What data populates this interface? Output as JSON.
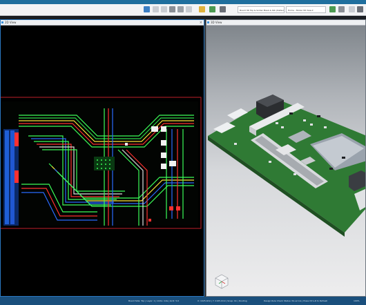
{
  "toolbar": {
    "layer_select": "Board 3D Top & Solder Mask & Silk (Default) ▾",
    "view_select": "Home - Model 3D View ▾",
    "icons": [
      "save-icon",
      "undo-icon",
      "redo-icon",
      "print-icon",
      "lock-icon",
      "zoom-icon",
      "measure-icon",
      "layer-icon",
      "settings-icon",
      "help-icon",
      "user-icon"
    ]
  },
  "pane_left": {
    "title": "2D View"
  },
  "pane_right": {
    "title": "3D View"
  },
  "status": {
    "item1": "Board Side: Top | Layer: 1 | Units: mils | Grid: 5.0",
    "item2": "X: 1025.0mil | Y: 2165.0mil | Snap: On | Routing",
    "item3": "Design Rule Check Status: No errors | Press Ctrl+R to Refresh",
    "item4": "100%"
  },
  "colors": {
    "accent": "#1f6f9e",
    "trace_green": "#3cff59",
    "trace_red": "#ff3030",
    "trace_blue": "#2a6bff",
    "pcb_green": "#2f7a34"
  }
}
